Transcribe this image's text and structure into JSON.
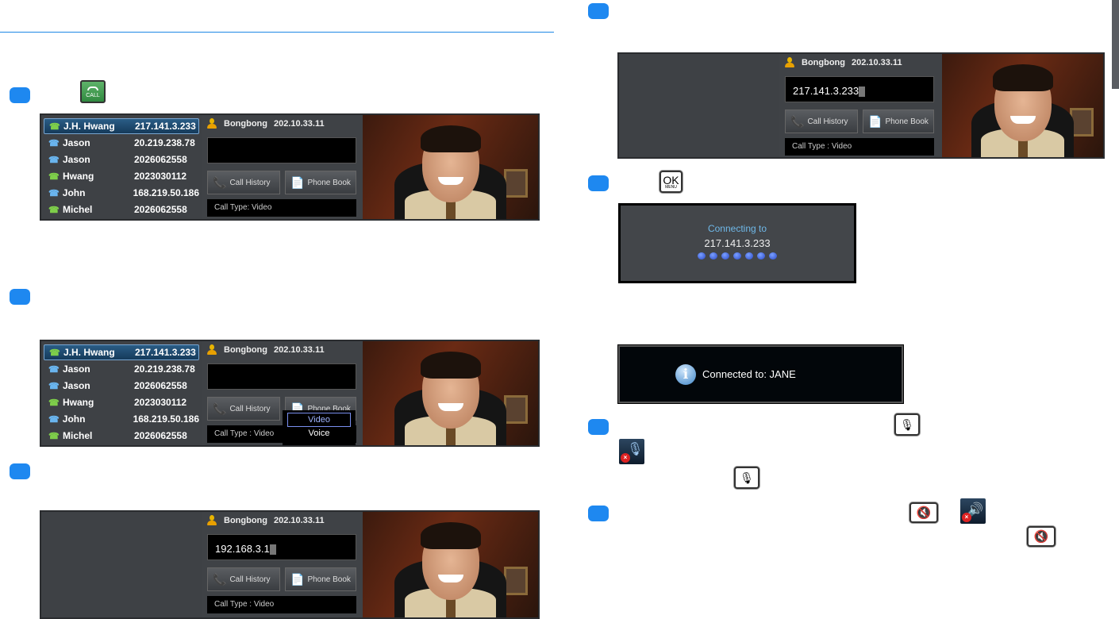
{
  "keys": {
    "call": "CALL",
    "ok": "OK",
    "menu": "MENU"
  },
  "list": [
    {
      "name": "J.H. Hwang",
      "number": "217.141.3.233",
      "dir": "out"
    },
    {
      "name": "Jason",
      "number": "20.219.238.78",
      "dir": "in"
    },
    {
      "name": "Jason",
      "number": "2026062558",
      "dir": "in"
    },
    {
      "name": "Hwang",
      "number": "2023030112",
      "dir": "out"
    },
    {
      "name": "John",
      "number": "168.219.50.186",
      "dir": "in"
    },
    {
      "name": "Michel",
      "number": "2026062558",
      "dir": "out"
    }
  ],
  "header": {
    "user": "Bongbong",
    "ip": "202.10.33.11"
  },
  "buttons": {
    "call_history": "Call History",
    "phone_book": "Phone Book"
  },
  "panels": [
    {
      "id": "panel-step1",
      "list": true,
      "input": "",
      "call_type": "Call Type: Video"
    },
    {
      "id": "panel-step2",
      "list": true,
      "input": "",
      "call_type": "Call Type : Video",
      "menu": [
        "Video",
        "Voice"
      ]
    },
    {
      "id": "panel-step3",
      "list": false,
      "input": "192.168.3.1",
      "call_type": "Call Type : Video"
    },
    {
      "id": "panel-step4",
      "list": false,
      "input": "217.141.3.233",
      "call_type": "Call Type : Video"
    }
  ],
  "connecting": {
    "label": "Connecting to",
    "address": "217.141.3.233",
    "dots": 7
  },
  "connected": {
    "message": "Connected to: JANE"
  },
  "colors": {
    "badge": "#1e88f0",
    "accent_line": "#1e88e5"
  }
}
